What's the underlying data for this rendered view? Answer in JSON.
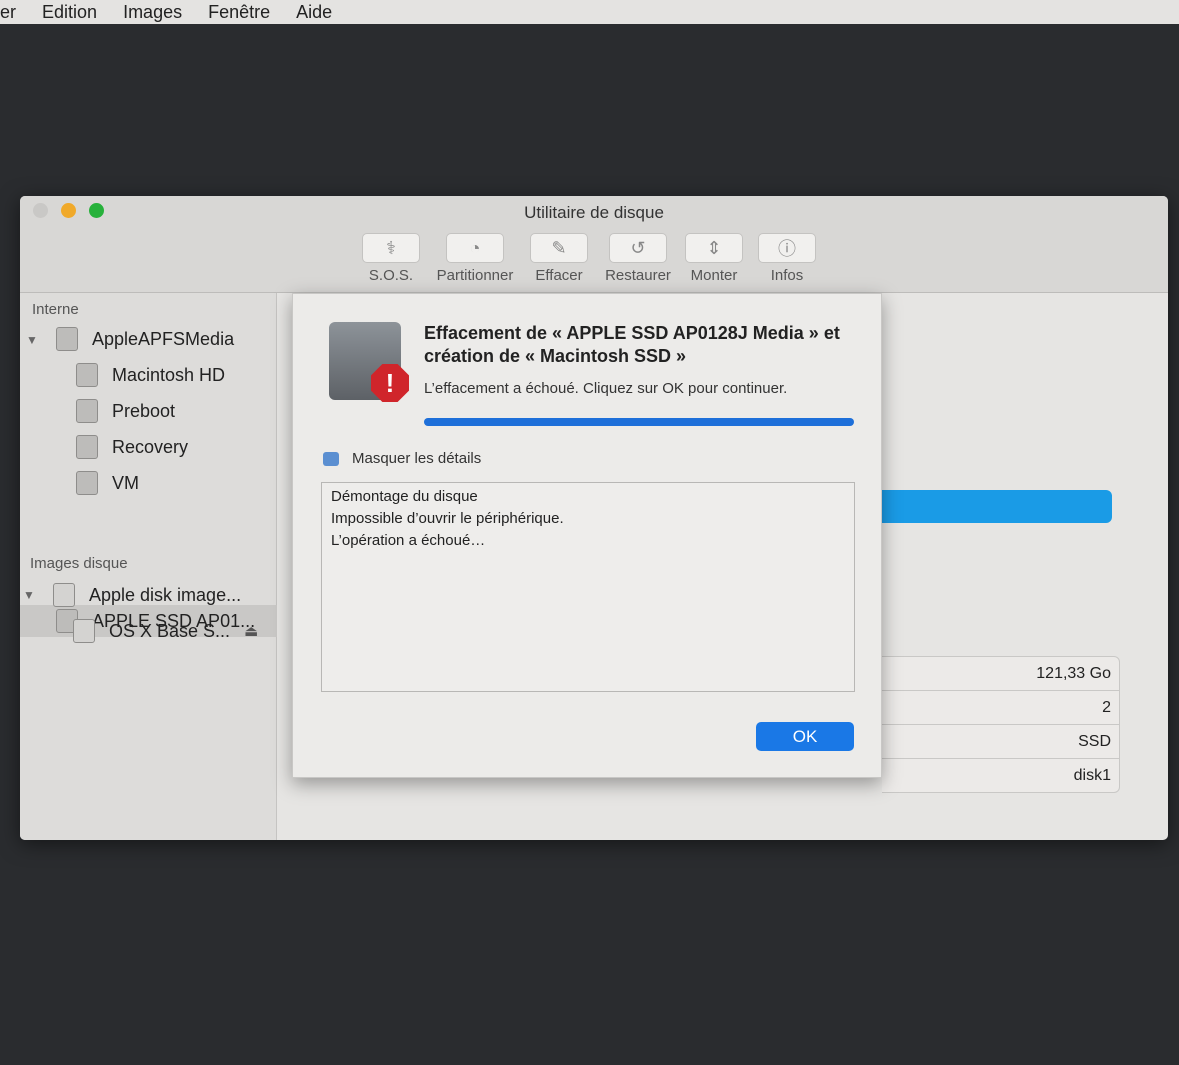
{
  "menubar": {
    "items": [
      "ier",
      "Edition",
      "Images",
      "Fenêtre",
      "Aide"
    ]
  },
  "window": {
    "title": "Utilitaire de disque"
  },
  "toolbar": [
    {
      "label": "S.O.S.",
      "icon": "stethoscope-icon",
      "glyph": "⚕"
    },
    {
      "label": "Partitionner",
      "icon": "partition-icon",
      "glyph": "◔"
    },
    {
      "label": "Effacer",
      "icon": "erase-icon",
      "glyph": "✎"
    },
    {
      "label": "Restaurer",
      "icon": "restore-icon",
      "glyph": "↺"
    },
    {
      "label": "Monter",
      "icon": "mount-icon",
      "glyph": "⇕"
    },
    {
      "label": "Infos",
      "icon": "info-icon",
      "glyph": "ⓘ"
    }
  ],
  "sidebar": {
    "internal_header": "Interne",
    "internal": [
      "AppleAPFSMedia",
      "Macintosh HD",
      "Preboot",
      "Recovery",
      "VM",
      "APPLE SSD AP01..."
    ],
    "images_header": "Images disque",
    "images": [
      "Apple disk image...",
      "OS X Base S..."
    ],
    "eject_glyph": "⏏"
  },
  "info_table": [
    "121,33 Go",
    "2",
    "SSD",
    "disk1"
  ],
  "dialog": {
    "title": "Effacement de « APPLE SSD AP0128J Media » et création de « Macintosh SSD »",
    "message": "L’effacement a échoué. Cliquez sur OK pour continuer.",
    "alert_glyph": "!",
    "progress": 1.0,
    "details_toggle": "Masquer les détails",
    "log": [
      "Démontage du disque",
      "Impossible d’ouvrir le périphérique.",
      "L’opération a échoué…"
    ],
    "ok": "OK"
  }
}
